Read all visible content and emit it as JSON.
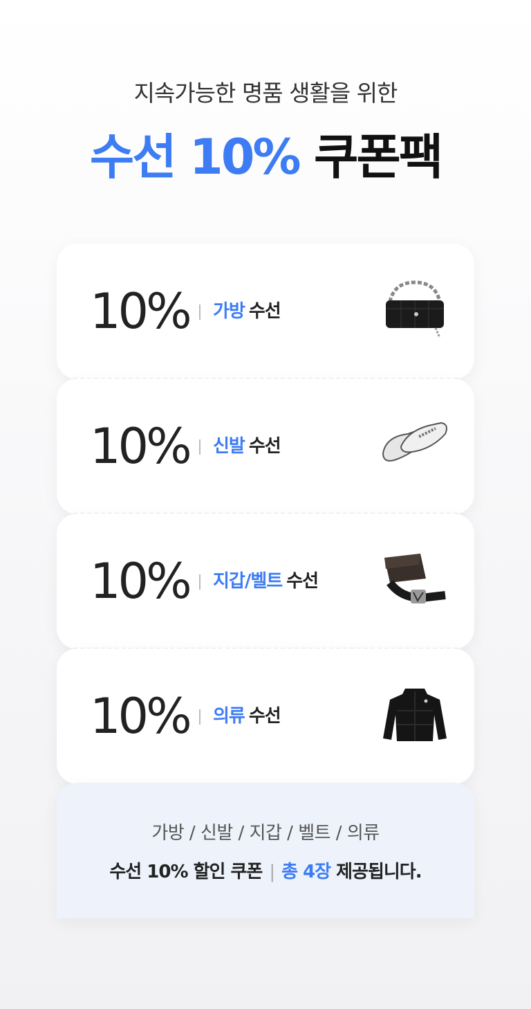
{
  "header": {
    "subtitle": "지속가능한 명품 생활을 위한",
    "title_accent": "수선 10%",
    "title_rest": "쿠폰팩"
  },
  "coupons": [
    {
      "discount": "10%",
      "category": "가방",
      "suffix": "수선",
      "icon": "handbag-icon"
    },
    {
      "discount": "10%",
      "category": "신발",
      "suffix": "수선",
      "icon": "loafer-shoes-icon"
    },
    {
      "discount": "10%",
      "category": "지갑/벨트",
      "suffix": "수선",
      "icon": "wallet-belt-icon"
    },
    {
      "discount": "10%",
      "category": "의류",
      "suffix": "수선",
      "icon": "jacket-icon"
    }
  ],
  "footer": {
    "categories_line": "가방 / 신발 / 지갑 / 벨트 / 의류",
    "coupon_desc": "수선 10% 할인 쿠폰",
    "count_text": "총 4장",
    "provided_text": "제공됩니다."
  },
  "colors": {
    "accent": "#3d7cf3",
    "text": "#222222",
    "footer_bg": "#eef3fb"
  }
}
